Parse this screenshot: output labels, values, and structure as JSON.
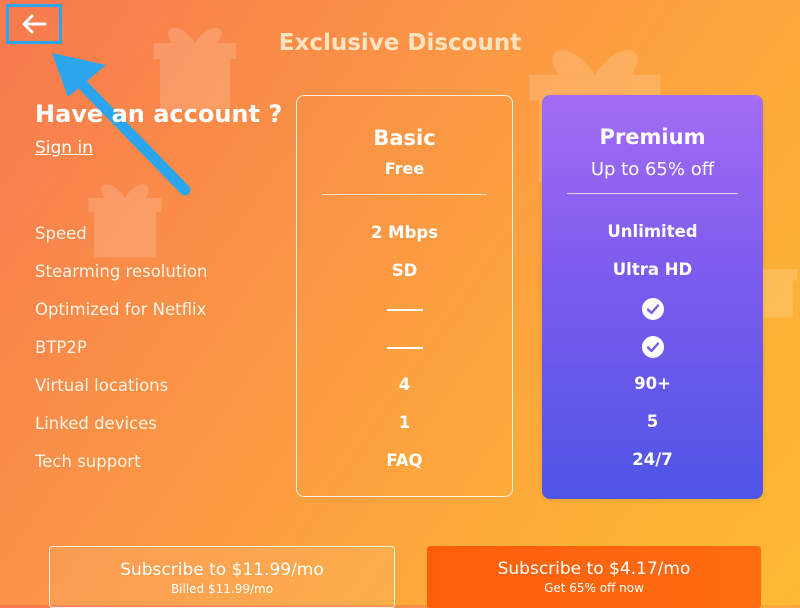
{
  "header": {
    "title": "Exclusive Discount",
    "back_icon": "arrow-left-icon"
  },
  "account": {
    "prompt": "Have an account ?",
    "sign_in": "Sign in"
  },
  "features": [
    "Speed",
    "Stearming resolution",
    "Optimized for Netflix",
    "BTP2P",
    "Virtual locations",
    "Linked devices",
    "Tech support"
  ],
  "plans": {
    "basic": {
      "name": "Basic",
      "sub": "Free",
      "values": [
        "2 Mbps",
        "SD",
        "—",
        "—",
        "4",
        "1",
        "FAQ"
      ]
    },
    "premium": {
      "name": "Premium",
      "sub": "Up to 65% off",
      "values": [
        "Unlimited",
        "Ultra HD",
        "check",
        "check",
        "90+",
        "5",
        "24/7"
      ]
    }
  },
  "buttons": {
    "basic": {
      "label": "Subscribe to $11.99/mo",
      "note": "Billed $11.99/mo"
    },
    "premium": {
      "label": "Subscribe to $4.17/mo",
      "note": "Get 65% off now"
    }
  },
  "colors": {
    "accent_blue": "#2ba6ee",
    "premium_top": "#a46cf3",
    "premium_bottom": "#4e55e6",
    "cta_orange": "#ff5d0a"
  }
}
